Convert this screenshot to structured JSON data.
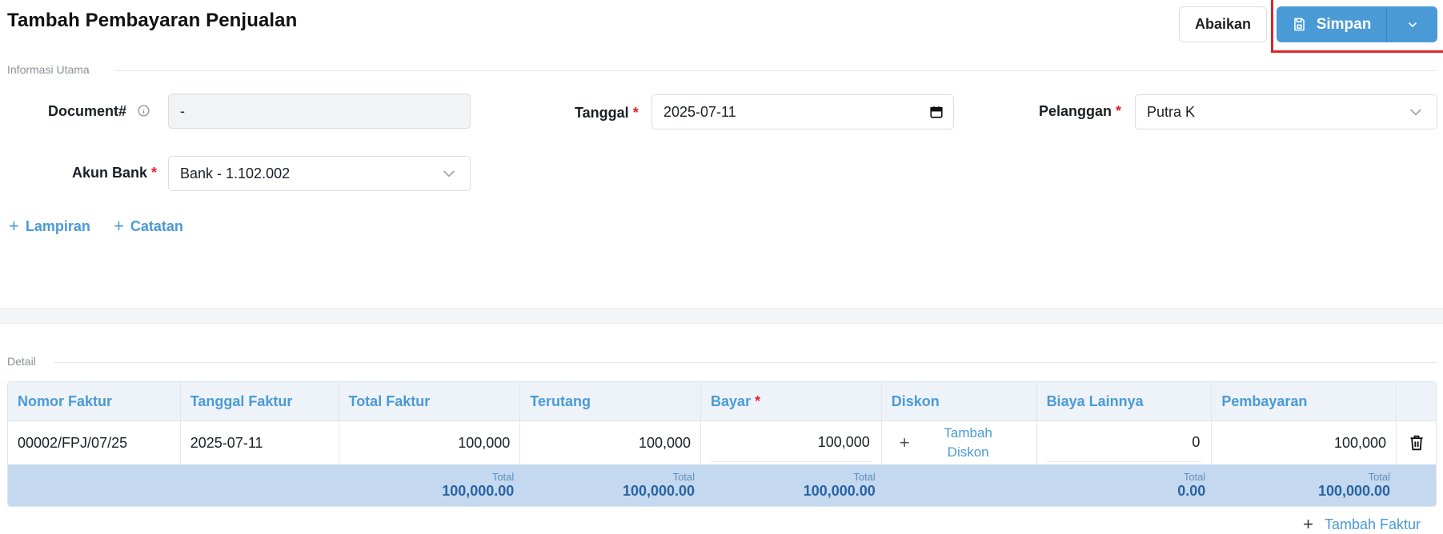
{
  "page": {
    "title": "Tambah Pembayaran Penjualan"
  },
  "toolbar": {
    "ignore_label": "Abaikan",
    "save_label": "Simpan"
  },
  "sections": {
    "main": "Informasi Utama",
    "detail": "Detail"
  },
  "form": {
    "document": {
      "label": "Document#",
      "value": "-"
    },
    "date": {
      "label": "Tanggal",
      "value": "2025-07-11"
    },
    "customer": {
      "label": "Pelanggan",
      "value": "Putra K"
    },
    "bank_account": {
      "label": "Akun Bank",
      "value": "Bank - 1.102.002"
    }
  },
  "links": {
    "attachment": "Lampiran",
    "note": "Catatan",
    "add_invoice": "Tambah Faktur"
  },
  "table": {
    "headers": [
      "Nomor Faktur",
      "Tanggal Faktur",
      "Total Faktur",
      "Terutang",
      "Bayar",
      "Diskon",
      "Biaya Lainnya",
      "Pembayaran"
    ],
    "rows": [
      {
        "invoice_no": "00002/FPJ/07/25",
        "invoice_date": "2025-07-11",
        "total": "100,000",
        "owed": "100,000",
        "pay": "100,000",
        "discount_action": "Tambah Diskon",
        "other_cost": "0",
        "payment": "100,000"
      }
    ],
    "totals": {
      "label": "Total",
      "total": "100,000.00",
      "owed": "100,000.00",
      "pay": "100,000.00",
      "other_cost": "0.00",
      "payment": "100,000.00"
    }
  },
  "colors": {
    "primary": "#4a9ad6",
    "required": "#e0232b",
    "highlight": "#e0232b",
    "footer_bg": "#c4d9ef"
  },
  "icons": [
    "save-icon",
    "chevron-down-icon",
    "info-icon",
    "calendar-icon",
    "plus-icon",
    "trash-icon"
  ]
}
